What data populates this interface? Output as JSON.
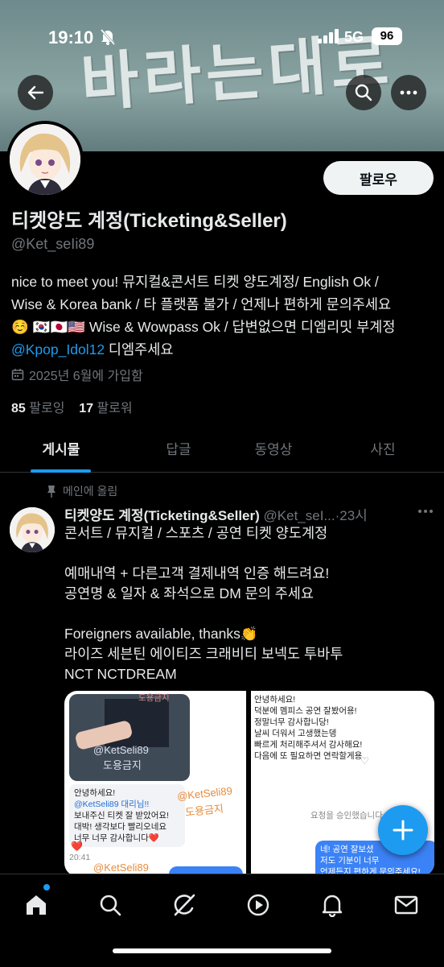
{
  "status_bar": {
    "time": "19:10",
    "network": "5G",
    "battery": "96"
  },
  "banner": {
    "text": "바라는대로"
  },
  "header": {
    "back_icon": "arrow-left-icon",
    "search_icon": "search-icon",
    "more_icon": "more-horizontal-icon"
  },
  "profile": {
    "follow_label": "팔로우",
    "display_name": "티켓양도 계정(Ticketing&Seller)",
    "handle": "@Ket_seIi89",
    "bio_line1": "nice to meet you! 뮤지컬&콘서트 티켓 양도계정/ English Ok /",
    "bio_line2": "Wise & Korea bank / 타 플랫폼 불가 / 언제나 편하게 문의주세요",
    "bio_line3": "☺️ 🇰🇷🇯🇵🇺🇸 Wise & Wowpass Ok / 답변없으면 디엠리밋 부계정",
    "bio_mention": "@Kpop_Idol12",
    "bio_line4_rest": " 디엠주세요",
    "joined": "2025년 6월에 가입함",
    "following_count": "85",
    "following_label": "팔로잉",
    "followers_count": "17",
    "followers_label": "팔로워"
  },
  "tabs": [
    {
      "label": "게시물",
      "active": true
    },
    {
      "label": "답글",
      "active": false
    },
    {
      "label": "동영상",
      "active": false
    },
    {
      "label": "사진",
      "active": false
    }
  ],
  "post": {
    "pinned_label": "메인에 올림",
    "name": "티켓양도 계정(Ticketing&Seller)",
    "handle": "@Ket_seI...",
    "time": "·23시",
    "lines": [
      "콘서트 / 뮤지컬 / 스포츠 / 공연 티켓 양도계정",
      "",
      "예매내역 + 다른고객 결제내역 인증 해드려요!",
      "공연명 & 일자 & 좌석으로 DM 문의 주세요",
      "",
      "Foreigners available, thanks👏",
      "라이즈 세븐틴 에이티즈 크래비티 보넥도 투바투",
      "NCT NCTDREAM"
    ],
    "media": {
      "left_watermark1": "도용금지",
      "left_watermark2": "@KetSeli89",
      "left_watermark3": "도용금지",
      "left_chat": [
        "안녕하세요!",
        "@KetSeli89 대리님!!",
        "보내주신 티켓 잘 받았어요!",
        "대박! 생각보다 빨리오네요",
        "너무 너무 감사합니다❤️"
      ],
      "left_chat_time": "20:41",
      "left_watermark4": "@KetSeli89",
      "left_watermark5": "도용금지",
      "left_watermark6": "@KetSeli89",
      "right_chat": [
        "안녕하세요!",
        "덕분에 멤피스 공연 잘봤어용!",
        "정말너무 감사합니당!",
        "날씨 더워서 고생했는뎅",
        "빠르게 처리해주셔서 감사해요!",
        "다음에 또 필요하면 연락할게용"
      ],
      "right_request": "요청을 승인했습니다",
      "right_bubble": [
        "네! 공연 잘보셨",
        "저도 기분이 너무",
        "언제든지 편하게 문의주세요!"
      ]
    }
  },
  "fab_icon": "plus-icon",
  "bottom_nav": [
    "home-icon",
    "search-icon",
    "grok-icon",
    "video-icon",
    "bell-icon",
    "mail-icon"
  ]
}
